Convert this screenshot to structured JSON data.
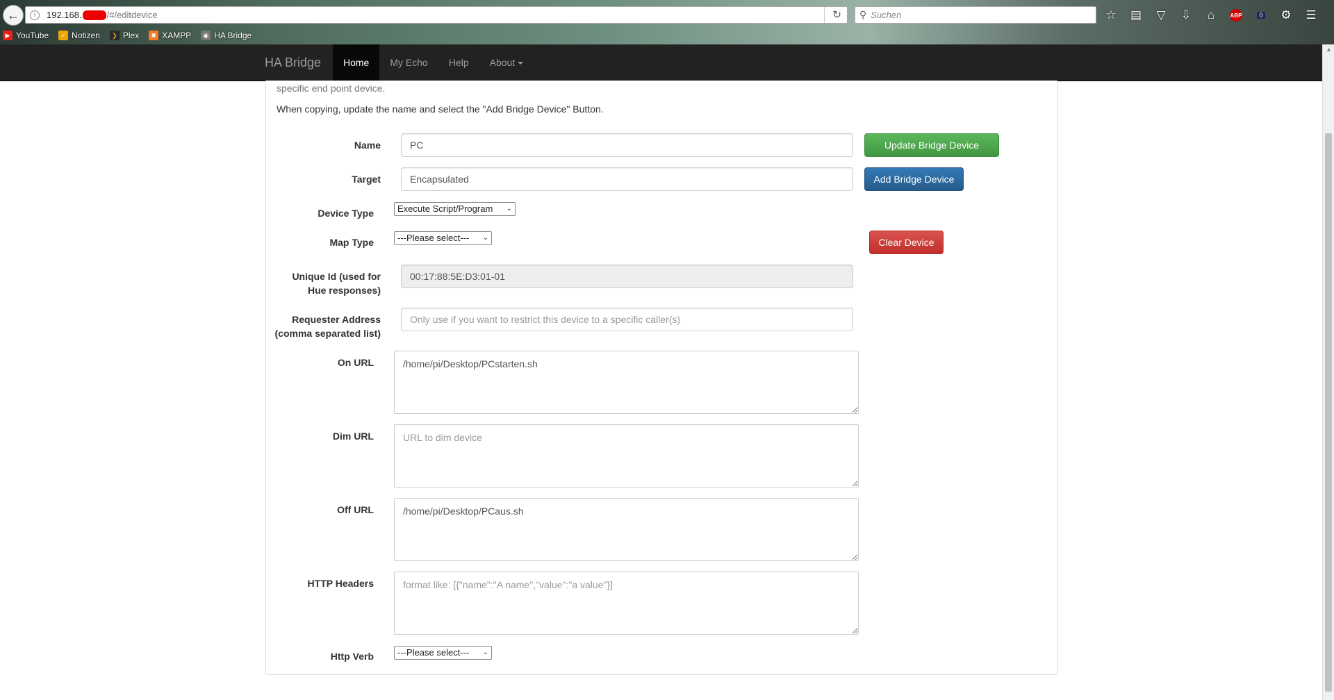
{
  "browser": {
    "url_host": "192.168.",
    "url_path": "/#/editdevice",
    "search_placeholder": "Suchen",
    "abp_label": "ABP",
    "badge_count": "0",
    "bookmarks": [
      {
        "label": "YouTube",
        "icon": "youtube-icon",
        "color": "#e62117"
      },
      {
        "label": "Notizen",
        "icon": "notes-icon",
        "color": "#f0a500"
      },
      {
        "label": "Plex",
        "icon": "plex-icon",
        "color": "#282a2d"
      },
      {
        "label": "XAMPP",
        "icon": "xampp-icon",
        "color": "#fb7a24"
      },
      {
        "label": "HA Bridge",
        "icon": "globe-icon",
        "color": "#777777"
      }
    ]
  },
  "navbar": {
    "brand": "HA Bridge",
    "items": [
      {
        "label": "Home",
        "active": true
      },
      {
        "label": "My Echo"
      },
      {
        "label": "Help"
      },
      {
        "label": "About"
      }
    ]
  },
  "intro": {
    "line1": "specific end point device.",
    "line2": "When copying, update the name and select the \"Add Bridge Device\" Button."
  },
  "form": {
    "name": {
      "label": "Name",
      "value": "PC"
    },
    "target": {
      "label": "Target",
      "value": "Encapsulated"
    },
    "device_type": {
      "label": "Device Type",
      "value": "Execute Script/Program"
    },
    "map_type": {
      "label": "Map Type",
      "value": "---Please select---"
    },
    "unique_id": {
      "label_line1": "Unique Id (used for",
      "label_line2": "Hue responses)",
      "value": "00:17:88:5E:D3:01-01"
    },
    "requester": {
      "label_line1": "Requester Address",
      "label_line2": "(comma separated list)",
      "placeholder": "Only use if you want to restrict this device to a specific caller(s)"
    },
    "on_url": {
      "label": "On URL",
      "value": "/home/pi/Desktop/PCstarten.sh"
    },
    "dim_url": {
      "label": "Dim URL",
      "placeholder": "URL to dim device"
    },
    "off_url": {
      "label": "Off URL",
      "value": "/home/pi/Desktop/PCaus.sh"
    },
    "http_headers": {
      "label": "HTTP Headers",
      "placeholder": "format like: [{\"name\":\"A name\",\"value\":\"a value\"}]"
    },
    "http_verb": {
      "label": "Http Verb",
      "value": "---Please select---"
    }
  },
  "buttons": {
    "update": "Update Bridge Device",
    "add": "Add Bridge Device",
    "clear": "Clear Device"
  },
  "colors": {
    "navbar_bg": "#222222",
    "success": "#5cb85c",
    "primary": "#337ab7",
    "danger": "#d9534f"
  }
}
